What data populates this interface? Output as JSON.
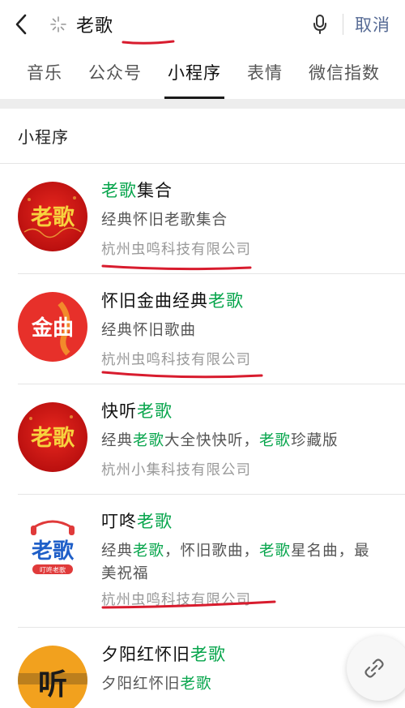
{
  "search": {
    "query": "老歌",
    "cancel_label": "取消"
  },
  "tabs": [
    {
      "label": "音乐"
    },
    {
      "label": "公众号"
    },
    {
      "label": "小程序"
    },
    {
      "label": "表情"
    },
    {
      "label": "微信指数"
    }
  ],
  "section_title": "小程序",
  "results": [
    {
      "name_parts": [
        "老歌",
        "集合"
      ],
      "desc": "经典怀旧老歌集合",
      "company": "杭州虫鸣科技有限公司",
      "logo_text": "老歌"
    },
    {
      "name_parts": [
        "怀旧金曲经典",
        "老歌"
      ],
      "desc": "经典怀旧歌曲",
      "company": "杭州虫鸣科技有限公司",
      "logo_text": "金曲"
    },
    {
      "name_parts": [
        "快听",
        "老歌"
      ],
      "desc_parts": [
        "经典",
        "老歌",
        "大全快快听，",
        "老歌",
        "珍藏版"
      ],
      "company": "杭州小集科技有限公司",
      "logo_text": "老歌"
    },
    {
      "name_parts": [
        "叮咚",
        "老歌"
      ],
      "desc_line1_parts": [
        "经典",
        "老歌",
        "，怀旧歌曲，",
        "老歌",
        "星名曲，最"
      ],
      "desc_line2": "美祝福",
      "company": "杭州虫鸣科技有限公司",
      "logo_text": "老歌",
      "logo_subtext": "叮咚老歌"
    },
    {
      "name_parts": [
        "夕阳红怀旧",
        "老歌"
      ],
      "desc_parts": [
        "夕阳红怀旧",
        "老歌"
      ],
      "logo_text": "听"
    }
  ],
  "colors": {
    "highlight": "#07a54c",
    "link": "#576b95",
    "annotation": "#d81c2e"
  }
}
